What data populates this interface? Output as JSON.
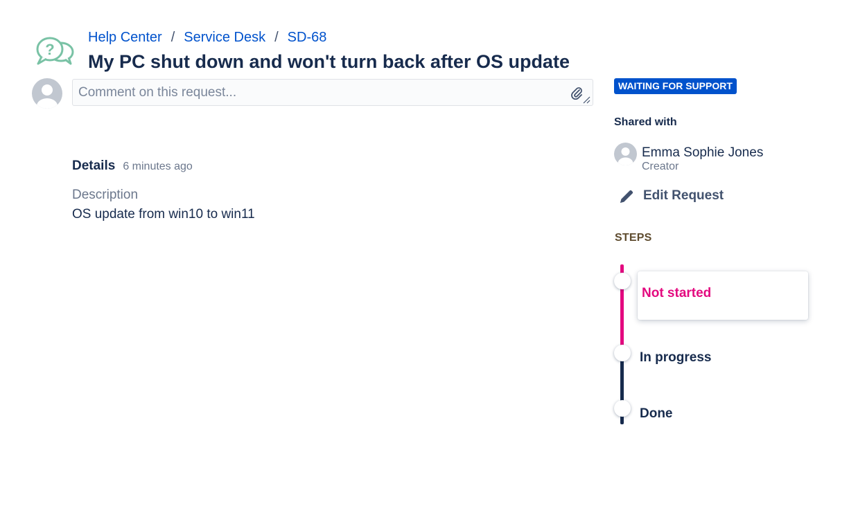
{
  "header": {
    "breadcrumb": [
      "Help Center",
      "Service Desk",
      "SD-68"
    ],
    "breadcrumb_separator": "/",
    "title": "My PC shut down and won't turn back after OS update"
  },
  "comment": {
    "placeholder": "Comment on this request...",
    "value": ""
  },
  "details": {
    "label": "Details",
    "time": "6 minutes ago",
    "description_label": "Description",
    "description_value": "OS update from win10 to win11"
  },
  "sidebar": {
    "status": "WAITING FOR SUPPORT",
    "shared_with_label": "Shared with",
    "user": {
      "name": "Emma Sophie Jones",
      "role": "Creator"
    },
    "edit_request": "Edit Request",
    "steps_label": "STEPS",
    "steps": [
      {
        "label": "Not started",
        "state": "current"
      },
      {
        "label": "In progress",
        "state": "upcoming"
      },
      {
        "label": "Done",
        "state": "upcoming"
      }
    ]
  },
  "icons": {
    "logo": "help-chat-bubbles-icon",
    "avatar": "user-avatar-icon",
    "attach": "paperclip-icon",
    "resize": "resize-handle-icon",
    "edit": "pencil-icon"
  },
  "colors": {
    "link": "#0052cc",
    "status_badge": "#0052cc",
    "current_step": "#e3097f",
    "step_track_done": "#e3097f",
    "step_track_pending": "#172b4d",
    "text_primary": "#172b4d",
    "text_subtle": "#6b778c",
    "logo": "#79c2a5"
  }
}
